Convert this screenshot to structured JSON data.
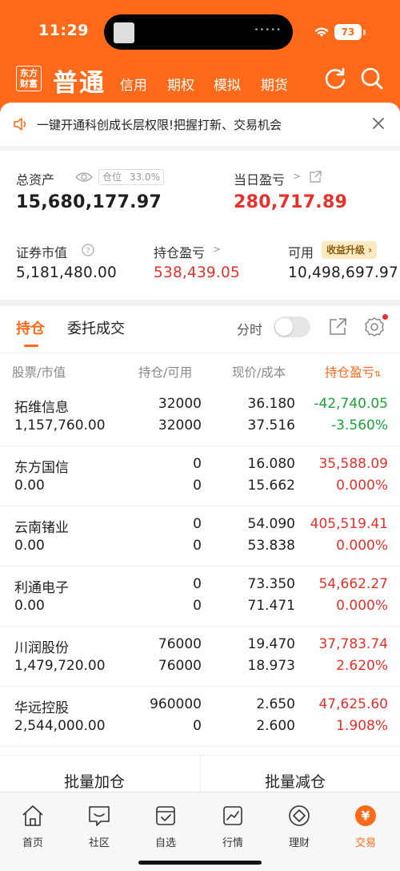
{
  "status_bar": {
    "time": "11:29",
    "battery": "73"
  },
  "header": {
    "logo_line1": "东方",
    "logo_line2": "财富",
    "active_tab": "普通",
    "tabs": [
      "信用",
      "期权",
      "模拟",
      "期货"
    ]
  },
  "notice": {
    "text": "一键开通科创成长层权限!把握打新、交易机会"
  },
  "assets": {
    "total_label": "总资产",
    "position_ratio_label": "仓位",
    "position_ratio": "33.0%",
    "total_value": "15,680,177.97",
    "daily_pl_label": "当日盈亏",
    "daily_pl_value": "280,717.89",
    "market_value_label": "证券市值",
    "market_value": "5,181,480.00",
    "holding_pl_label": "持仓盈亏",
    "holding_pl_value": "538,439.05",
    "available_label": "可用",
    "upgrade_label": "收益升级",
    "available_value": "10,498,697.97"
  },
  "positions": {
    "tab_holdings": "持仓",
    "tab_orders": "委托成交",
    "fenshi_label": "分时",
    "headers": {
      "stock": "股票",
      "market_value": "市值",
      "qty": "持仓",
      "available": "可用",
      "price": "现价",
      "cost": "成本",
      "pl": "持仓盈亏"
    },
    "rows": [
      {
        "name": "拓维信息",
        "value": "1,157,760.00",
        "qty": "32000",
        "avail": "32000",
        "price": "36.180",
        "cost": "37.516",
        "pl": "-42,740.05",
        "pl_pct": "-3.560%",
        "dir": "down"
      },
      {
        "name": "东方国信",
        "value": "0.00",
        "qty": "0",
        "avail": "0",
        "price": "16.080",
        "cost": "15.662",
        "pl": "35,588.09",
        "pl_pct": "0.000%",
        "dir": "up"
      },
      {
        "name": "云南锗业",
        "value": "0.00",
        "qty": "0",
        "avail": "0",
        "price": "54.090",
        "cost": "53.838",
        "pl": "405,519.41",
        "pl_pct": "0.000%",
        "dir": "up"
      },
      {
        "name": "利通电子",
        "value": "0.00",
        "qty": "0",
        "avail": "0",
        "price": "73.350",
        "cost": "71.471",
        "pl": "54,662.27",
        "pl_pct": "0.000%",
        "dir": "up"
      },
      {
        "name": "川润股份",
        "value": "1,479,720.00",
        "qty": "76000",
        "avail": "76000",
        "price": "19.470",
        "cost": "18.973",
        "pl": "37,783.74",
        "pl_pct": "2.620%",
        "dir": "up"
      },
      {
        "name": "华远控股",
        "value": "2,544,000.00",
        "qty": "960000",
        "avail": "0",
        "price": "2.650",
        "cost": "2.600",
        "pl": "47,625.60",
        "pl_pct": "1.908%",
        "dir": "up"
      }
    ]
  },
  "batch": {
    "add": "批量加仓",
    "reduce": "批量减仓"
  },
  "tabbar": [
    {
      "label": "首页",
      "icon": "home-icon"
    },
    {
      "label": "社区",
      "icon": "community-icon"
    },
    {
      "label": "自选",
      "icon": "watchlist-icon"
    },
    {
      "label": "行情",
      "icon": "market-icon"
    },
    {
      "label": "理财",
      "icon": "wealth-icon"
    },
    {
      "label": "交易",
      "icon": "trade-icon"
    }
  ],
  "colors": {
    "brand": "#ff6a1a",
    "up": "#e8302a",
    "down": "#1aa33a"
  }
}
